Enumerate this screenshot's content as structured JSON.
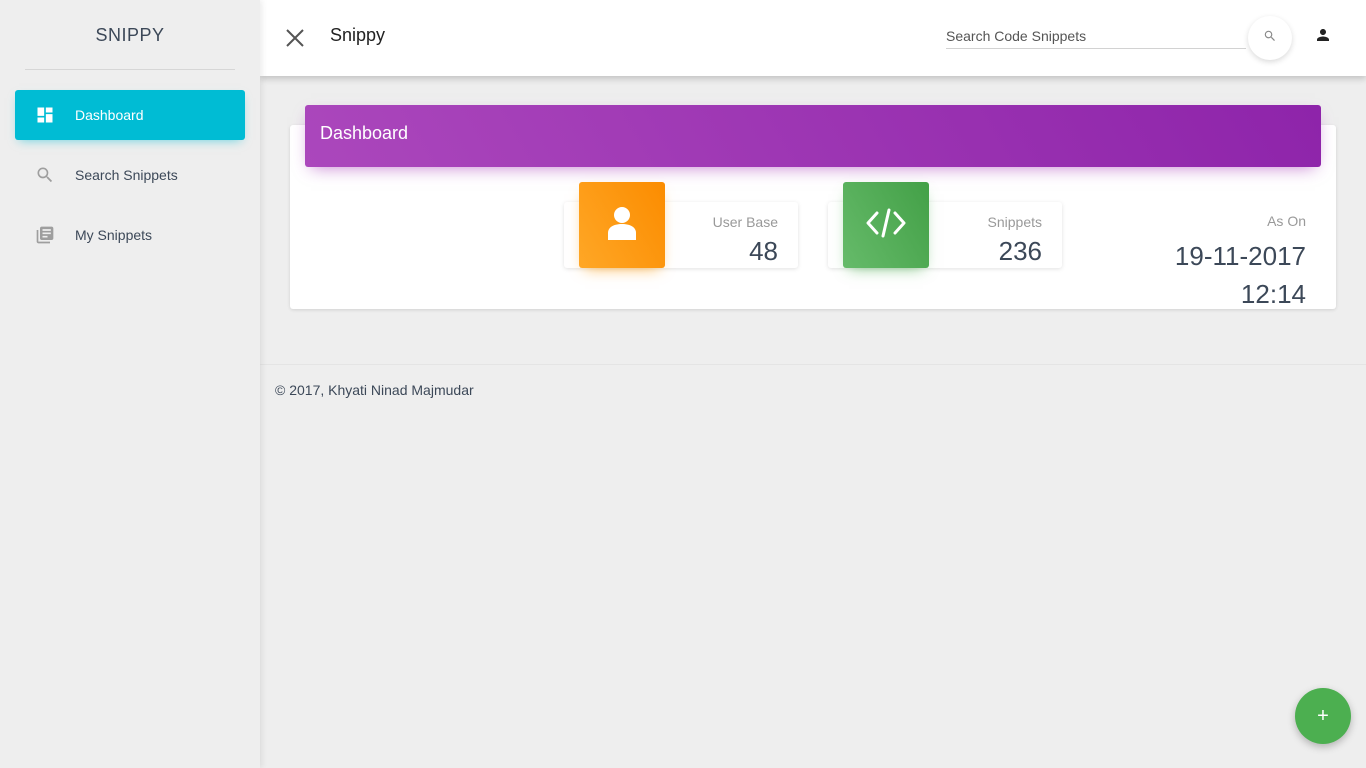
{
  "sidebar": {
    "brand": "SNIPPY",
    "items": [
      {
        "label": "Dashboard",
        "icon": "dashboard-icon",
        "active": true
      },
      {
        "label": "Search Snippets",
        "icon": "search-icon",
        "active": false
      },
      {
        "label": "My Snippets",
        "icon": "library-books-icon",
        "active": false
      }
    ]
  },
  "topbar": {
    "title": "Snippy",
    "search_placeholder": "Search Code Snippets",
    "close_icon": "close-icon",
    "search_icon": "search-icon",
    "user_icon": "person-icon"
  },
  "dashboard": {
    "header": "Dashboard",
    "stats": [
      {
        "label": "User Base",
        "value": "48",
        "icon": "person-icon",
        "color": "#fb8c00"
      },
      {
        "label": "Snippets",
        "value": "236",
        "icon": "code-icon",
        "color": "#43a047"
      }
    ],
    "as_on": {
      "label": "As On",
      "date": "19-11-2017",
      "time": "12:14"
    }
  },
  "footer": {
    "text": "© 2017, Khyati Ninad Majmudar"
  },
  "fab": {
    "label": "+"
  },
  "colors": {
    "accent": "#00bcd4",
    "header": "#9c27b0",
    "orange": "#ff9800",
    "green": "#4caf50"
  }
}
